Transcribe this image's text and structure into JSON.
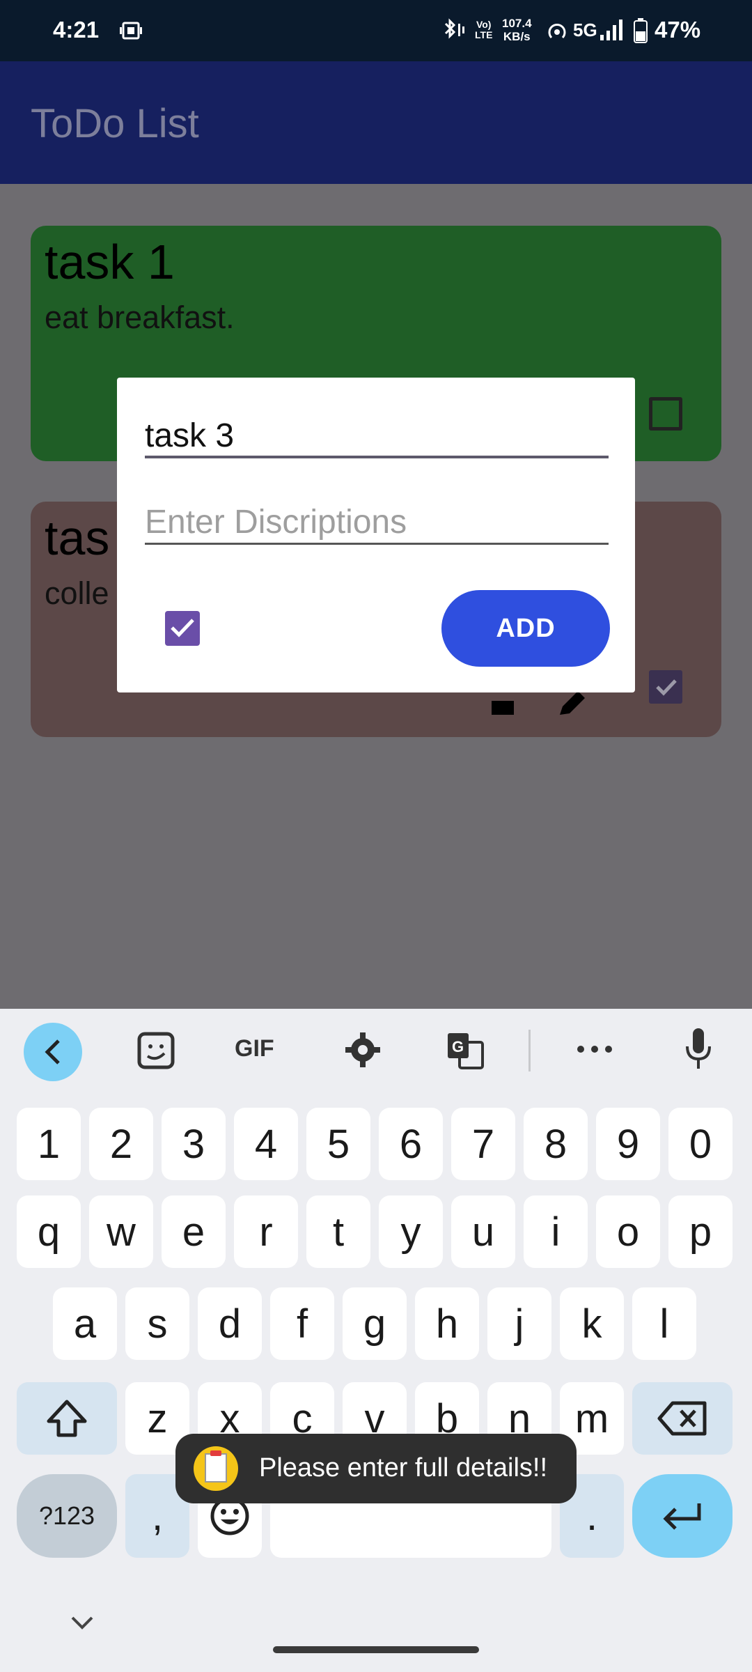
{
  "status_bar": {
    "time": "4:21",
    "volte_line1": "Vo)",
    "volte_line2": "LTE",
    "rate_value": "107.4",
    "rate_unit": "KB/s",
    "network": "5G",
    "battery": "47%"
  },
  "app_bar": {
    "title": "ToDo List"
  },
  "tasks": [
    {
      "title": "task 1",
      "description": "eat breakfast.",
      "done": false,
      "color": "#1f5e26"
    },
    {
      "title": "tas",
      "description": "colle",
      "done": true,
      "color": "#5c4848"
    }
  ],
  "dialog": {
    "title_value": "task 3",
    "description_placeholder": "Enter Discriptions",
    "checked": true,
    "add_label": "ADD"
  },
  "keyboard": {
    "toolbar": {
      "gif_label": "GIF",
      "more_label": "…"
    },
    "number_row": [
      "1",
      "2",
      "3",
      "4",
      "5",
      "6",
      "7",
      "8",
      "9",
      "0"
    ],
    "row1": [
      "q",
      "w",
      "e",
      "r",
      "t",
      "y",
      "u",
      "i",
      "o",
      "p"
    ],
    "row2": [
      "a",
      "s",
      "d",
      "f",
      "g",
      "h",
      "j",
      "k",
      "l"
    ],
    "row3": [
      "z",
      "x",
      "c",
      "v",
      "b",
      "n",
      "m"
    ],
    "symbols_label": "?123",
    "comma_label": ",",
    "period_label": "."
  },
  "toast": {
    "message": "Please enter full details!!"
  },
  "colors": {
    "app_bar": "#16205f",
    "accent_button": "#2f4fdf",
    "fab": "#121d6e",
    "checkbox": "#6a4ea8"
  }
}
